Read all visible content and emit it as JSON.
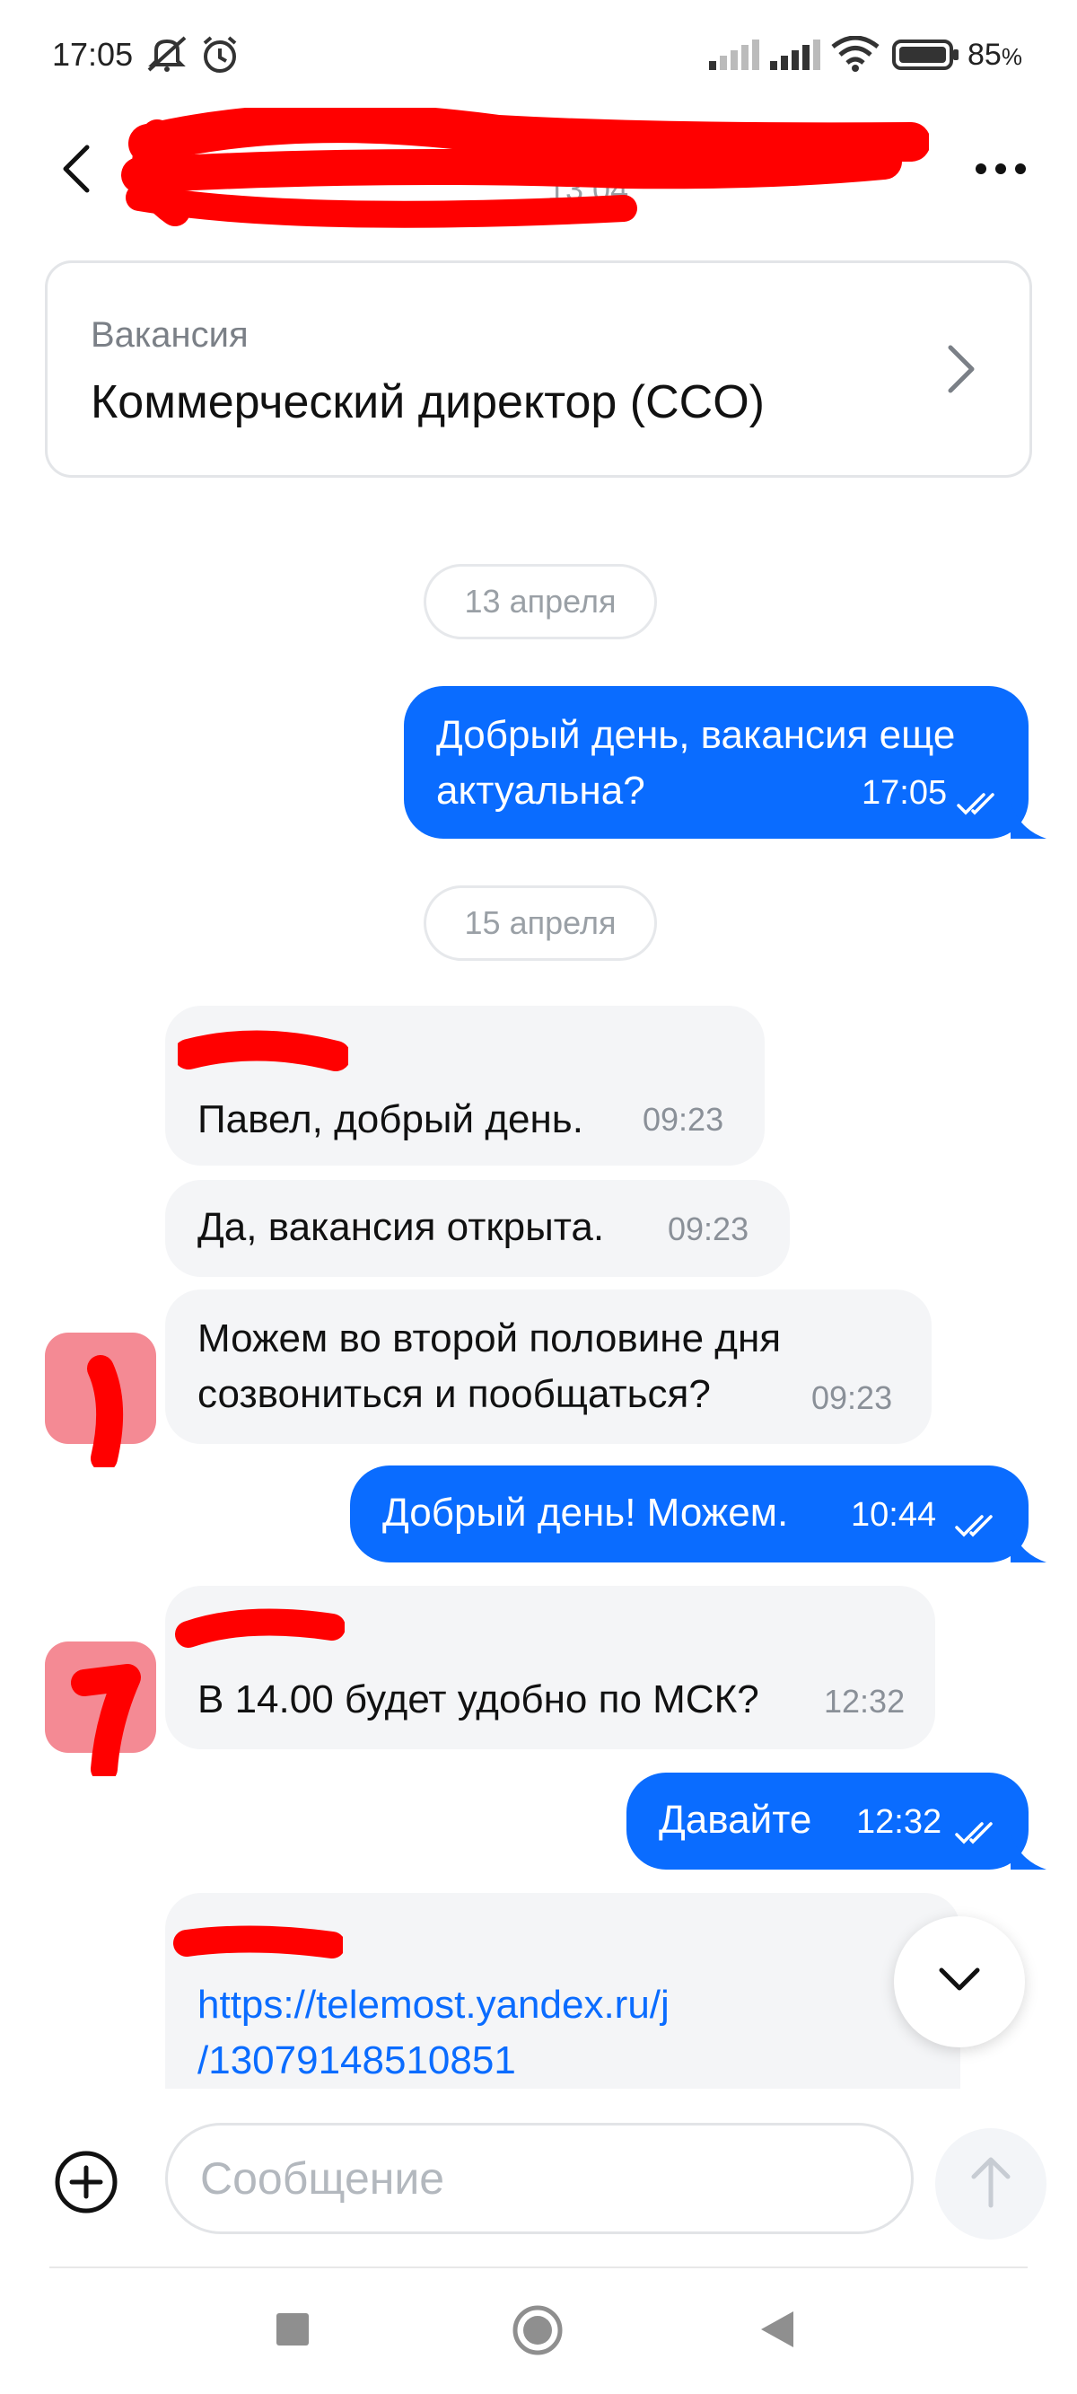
{
  "status_bar": {
    "time": "17:05",
    "battery_percent": "85",
    "battery_symbol": "%"
  },
  "header": {
    "last_seen_time": "13:04"
  },
  "vacancy": {
    "label": "Вакансия",
    "title": "Коммерческий директор (CCO)"
  },
  "dates": [
    "13 апреля",
    "15 апреля"
  ],
  "messages": [
    {
      "direction": "out",
      "text": "Добрый день, вакансия еще\nактуальна?",
      "time": "17:05"
    },
    {
      "direction": "in",
      "text": "Павел, добрый день.",
      "time": "09:23"
    },
    {
      "direction": "in",
      "text": "Да, вакансия открыта.",
      "time": "09:23"
    },
    {
      "direction": "in",
      "text": "Можем во второй половине дня\nсозвониться и пообщаться?",
      "time": "09:23"
    },
    {
      "direction": "out",
      "text": "Добрый день! Можем.",
      "time": "10:44"
    },
    {
      "direction": "in",
      "text": "В 14.00 будет удобно по МСК?",
      "time": "12:32"
    },
    {
      "direction": "out",
      "text": "Давайте",
      "time": "12:32"
    },
    {
      "direction": "in",
      "text": "https://telemost.yandex.ru/j\n/13079148510851",
      "time": ""
    }
  ],
  "input": {
    "placeholder": "Сообщение"
  },
  "colors": {
    "outgoing_bubble": "#0a6cff",
    "incoming_bubble": "#f4f5f7",
    "redaction": "#ff0000",
    "avatar": "#f48a94"
  },
  "icons": {
    "back": "chevron-left-icon",
    "more": "more-dots-icon",
    "vacancy_open": "chevron-right-icon",
    "read_status": "double-check-icon",
    "scroll_down": "chevron-down-icon",
    "attach": "plus-circle-icon",
    "send": "arrow-up-icon",
    "nav_recents": "square-icon",
    "nav_home": "circle-icon",
    "nav_back": "triangle-back-icon"
  }
}
